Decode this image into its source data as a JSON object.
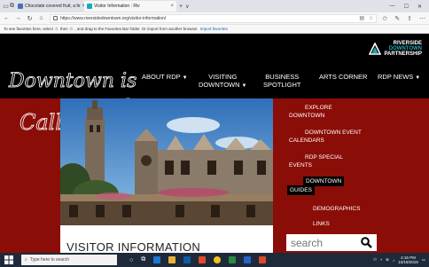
{
  "browser": {
    "tabs": [
      {
        "label": "Chocolate covered fruit, a fe",
        "active": false
      },
      {
        "label": "Visitor Information : Riv",
        "active": true
      }
    ],
    "new_tab_glyph": "+",
    "tab_menu_glyph": "∨",
    "address": "https://www.riversidedowntown.org/visitor-information/",
    "favorites_prompt": "To see favorites here, select",
    "favorites_prompt_2": "then",
    "favorites_prompt_3": ", and drag to the Favorites Bar folder. Or import from another browser.",
    "import_link": "Import favorites"
  },
  "site": {
    "logo_script_line1": "Downtown is",
    "logo_script_line2": "Calling",
    "rdp_logo": [
      "RIVERSIDE",
      "DOWNTOWN",
      "PARTNERSHIP"
    ],
    "nav": [
      {
        "line1": "ABOUT RDP",
        "line2": "",
        "chevron": true
      },
      {
        "line1": "VISITING",
        "line2": "DOWNTOWN",
        "chevron": true
      },
      {
        "line1": "BUSINESS",
        "line2": "SPOTLIGHT",
        "chevron": false
      },
      {
        "line1": "ARTS CORNER",
        "line2": "",
        "chevron": false
      },
      {
        "line1": "RDP NEWS",
        "line2": "",
        "chevron": true
      }
    ],
    "side_menu": [
      {
        "line1": "EXPLORE",
        "line2": "DOWNTOWN"
      },
      {
        "line1": "DOWNTOWN EVENT",
        "line2": "CALENDARS"
      },
      {
        "line1": "RDP SPECIAL",
        "line2": "EVENTS"
      },
      {
        "line1": "DOWNTOWN",
        "line2": "GUIDES"
      },
      {
        "line1": "DEMOGRAPHICS",
        "line2": ""
      },
      {
        "line1": "LINKS",
        "line2": ""
      }
    ],
    "content_title": "VISITOR INFORMATION",
    "search_placeholder": "search",
    "colors": {
      "brand_red": "#8b0d07",
      "black": "#000000",
      "logo_teal": "#1aa9b7"
    }
  },
  "taskbar": {
    "search_placeholder": "Type here to search",
    "time": "4:16 PM",
    "date": "10/19/2019"
  }
}
